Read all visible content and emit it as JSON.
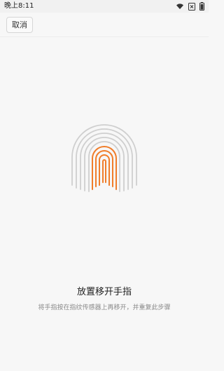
{
  "status_bar": {
    "time": "晚上8:11",
    "icons": [
      "wifi-icon",
      "sim-off-icon",
      "battery-icon"
    ]
  },
  "toolbar": {
    "cancel_label": "取消"
  },
  "main": {
    "title": "放置移开手指",
    "instruction": "将手指按在指纹传感器上再移开，并重复此步骤"
  },
  "colors": {
    "accent": "#f07d2a",
    "fingerprint_gray": "#cfcfcf",
    "background": "#f7f7f7"
  },
  "icons": {
    "fingerprint": "fingerprint-icon"
  }
}
